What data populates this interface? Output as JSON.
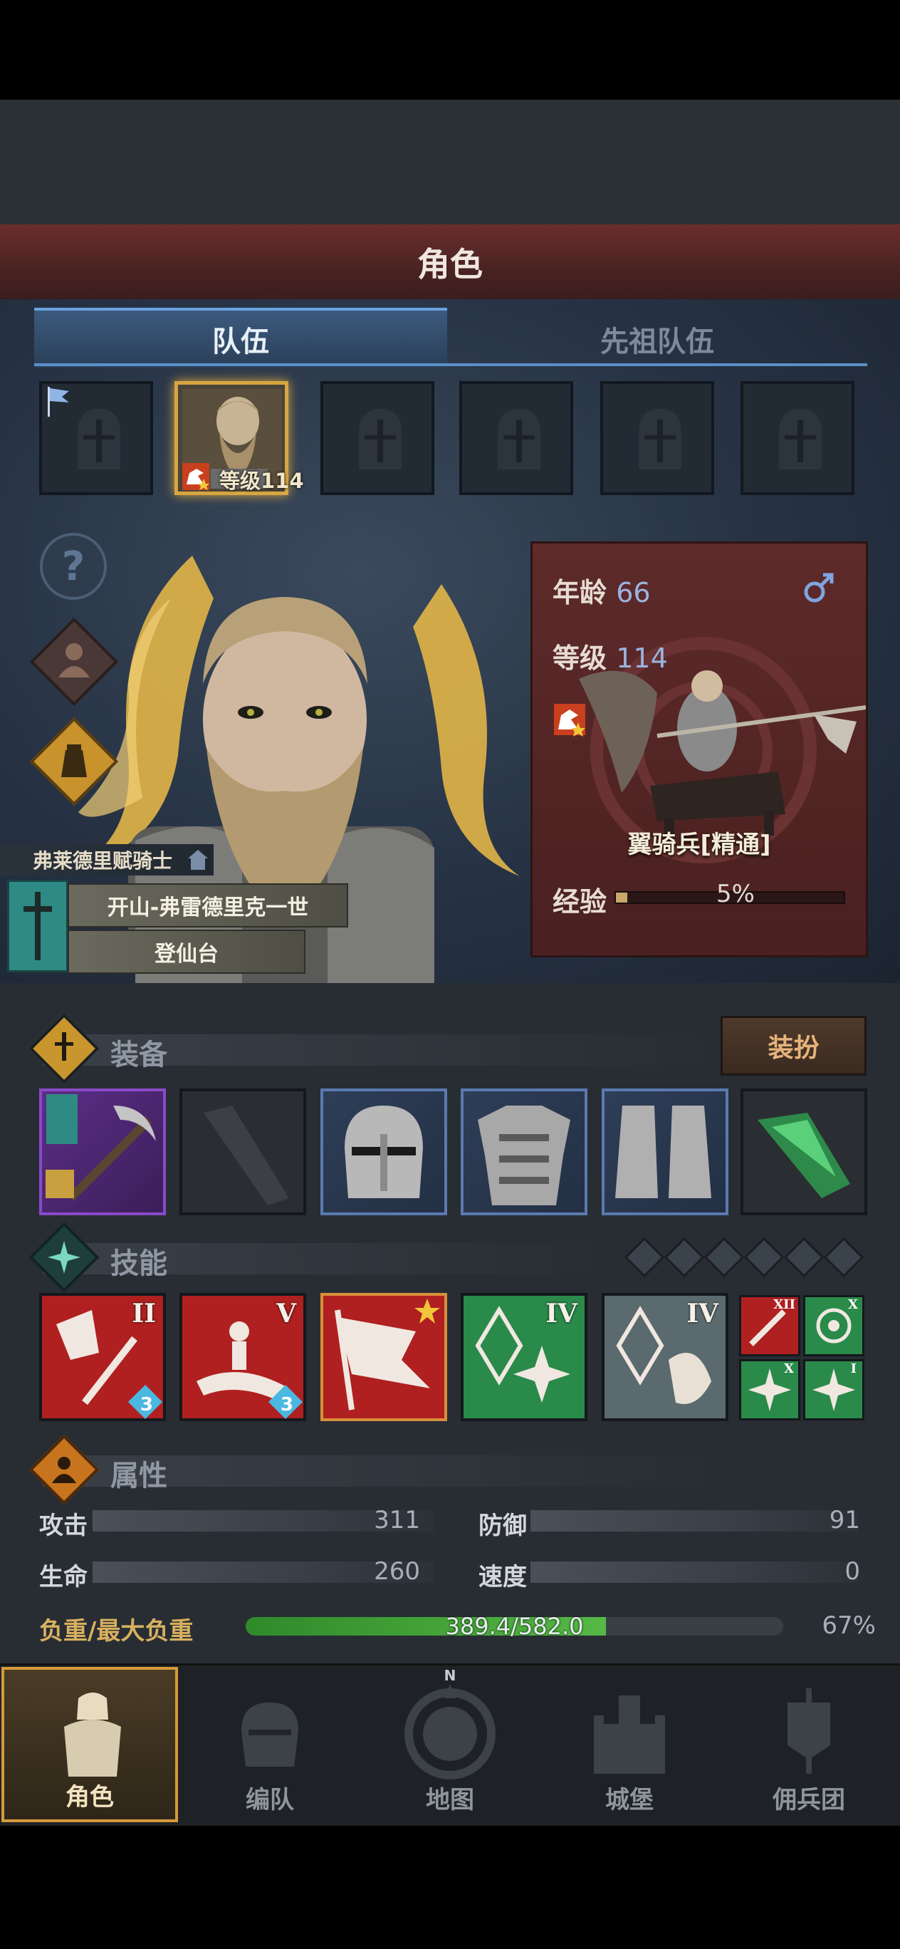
{
  "header": {
    "title": "角色"
  },
  "tabs": [
    {
      "label": "队伍",
      "active": true
    },
    {
      "label": "先祖队伍",
      "active": false
    }
  ],
  "team_slots": {
    "active_index": 1,
    "active_level_label": "等级114"
  },
  "character": {
    "age_label": "年龄",
    "age_value": "66",
    "level_label": "等级",
    "level_value": "114",
    "class_name": "翼骑兵[精通]",
    "exp_label": "经验",
    "exp_percent_text": "5%",
    "exp_fraction": 0.05,
    "gender_icon": "male-symbol-icon",
    "title": "弗莱德里赋骑士",
    "name": "开山-弗雷德里克一世",
    "status": "登仙台"
  },
  "sections": {
    "equipment": "装备",
    "outfit_button": "装扮",
    "skills": "技能",
    "attributes": "属性"
  },
  "equipment_items": [
    "pickaxe-weapon-icon",
    "empty-offhand-icon",
    "helmet-icon",
    "chest-armor-icon",
    "boots-icon",
    "green-crystal-trinket-icon"
  ],
  "skills": [
    {
      "numeral": "II",
      "badge": "3",
      "icon": "broken-sword-skill-icon"
    },
    {
      "numeral": "V",
      "badge": "3",
      "icon": "rally-skill-icon"
    },
    {
      "numeral": "",
      "badge": "",
      "icon": "banner-skill-icon",
      "starred": true
    },
    {
      "numeral": "IV",
      "badge": "",
      "icon": "crystal-burst-skill-icon"
    },
    {
      "numeral": "IV",
      "badge": "",
      "icon": "crystal-shield-skill-icon"
    }
  ],
  "small_skills": [
    {
      "numeral": "XII",
      "icon": "sword-passive-icon"
    },
    {
      "numeral": "X",
      "icon": "target-passive-icon"
    },
    {
      "numeral": "X",
      "icon": "burst-passive-icon"
    },
    {
      "numeral": "I",
      "icon": "burst-passive-icon"
    }
  ],
  "stats": {
    "attack_label": "攻击",
    "attack_value": "311",
    "defense_label": "防御",
    "defense_value": "91",
    "hp_label": "生命",
    "hp_value": "260",
    "speed_label": "速度",
    "speed_value": "0",
    "load_label": "负重/最大负重",
    "load_value": "389.4/582.0",
    "load_percent_text": "67%",
    "load_fraction": 0.67
  },
  "nav": [
    {
      "label": "角色",
      "active": true
    },
    {
      "label": "编队",
      "active": false
    },
    {
      "label": "地图",
      "active": false
    },
    {
      "label": "城堡",
      "active": false
    },
    {
      "label": "佣兵团",
      "active": false
    }
  ],
  "compass_letter": "N",
  "colors": {
    "accent_gold": "#d8a640",
    "tab_blue": "#5c8fc8",
    "load_green": "#4caa3a",
    "header_red": "#5a2828"
  }
}
